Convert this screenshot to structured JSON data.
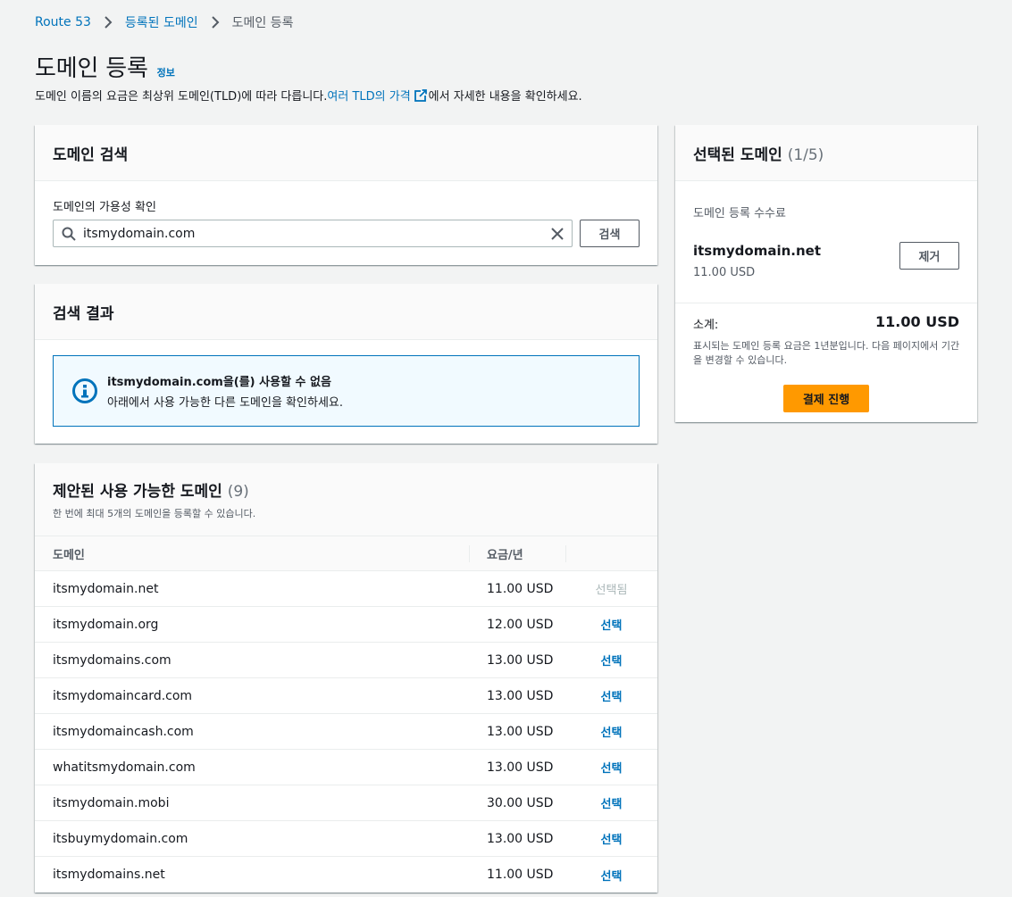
{
  "breadcrumb": {
    "items": [
      "Route 53",
      "등록된 도메인"
    ],
    "current": "도메인 등록"
  },
  "header": {
    "title": "도메인 등록",
    "info": "정보",
    "desc_prefix": "도메인 이름의 요금은 최상위 도메인(TLD)에 따라 다릅니다. ",
    "desc_link": "여러 TLD의 가격",
    "desc_suffix": "에서 자세한 내용을 확인하세요."
  },
  "search": {
    "title": "도메인 검색",
    "label": "도메인의 가용성 확인",
    "value": "itsmydomain.com",
    "button": "검색"
  },
  "results": {
    "title": "검색 결과",
    "alert_title": "itsmydomain.com을(를) 사용할 수 없음",
    "alert_body": "아래에서 사용 가능한 다른 도메인을 확인하세요."
  },
  "suggestions": {
    "title": "제안된 사용 가능한 도메인",
    "count": "(9)",
    "subtitle": "한 번에 최대 5개의 도메인을 등록할 수 있습니다.",
    "col_domain": "도메인",
    "col_price": "요금/년",
    "rows": [
      {
        "domain": "itsmydomain.net",
        "price": "11.00 USD",
        "action": "선택됨"
      },
      {
        "domain": "itsmydomain.org",
        "price": "12.00 USD",
        "action": "선택"
      },
      {
        "domain": "itsmydomains.com",
        "price": "13.00 USD",
        "action": "선택"
      },
      {
        "domain": "itsmydomaincard.com",
        "price": "13.00 USD",
        "action": "선택"
      },
      {
        "domain": "itsmydomaincash.com",
        "price": "13.00 USD",
        "action": "선택"
      },
      {
        "domain": "whatitsmydomain.com",
        "price": "13.00 USD",
        "action": "선택"
      },
      {
        "domain": "itsmydomain.mobi",
        "price": "30.00 USD",
        "action": "선택"
      },
      {
        "domain": "itsbuymydomain.com",
        "price": "13.00 USD",
        "action": "선택"
      },
      {
        "domain": "itsmydomains.net",
        "price": "11.00 USD",
        "action": "선택"
      }
    ]
  },
  "selected": {
    "title": "선택된 도메인",
    "count": "(1/5)",
    "fee_label": "도메인 등록 수수료",
    "domain": "itsmydomain.net",
    "price": "11.00 USD",
    "remove": "제거",
    "subtotal_label": "소계:",
    "subtotal_value": "11.00 USD",
    "note": "표시되는 도메인 등록 요금은 1년분입니다. 다음 페이지에서 기간을 변경할 수 있습니다.",
    "checkout": "결제 진행"
  },
  "colors": {
    "link": "#0073bb",
    "primary": "#ff9900",
    "alert_bg": "#f1faff",
    "background": "#f2f3f3"
  },
  "icons": [
    "chevron-right-icon",
    "external-link-icon",
    "search-icon",
    "close-icon",
    "info-icon"
  ]
}
